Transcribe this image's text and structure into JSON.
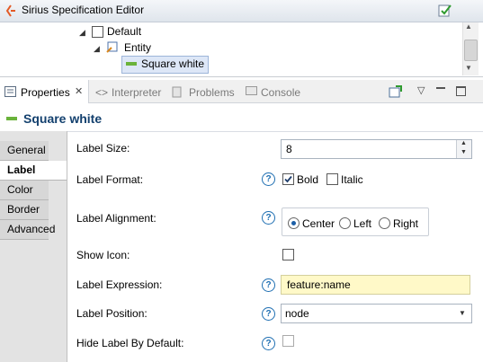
{
  "tree": {
    "title": "Sirius Specification Editor",
    "nodes": [
      {
        "label": "Default"
      },
      {
        "label": "Entity"
      },
      {
        "label": "Square white"
      }
    ]
  },
  "tabs": [
    {
      "label": "Properties",
      "active": true
    },
    {
      "label": "Interpreter",
      "active": false
    },
    {
      "label": "Problems",
      "active": false
    },
    {
      "label": "Console",
      "active": false
    }
  ],
  "section": {
    "title": "Square white"
  },
  "side_tabs": [
    {
      "label": "General"
    },
    {
      "label": "Label"
    },
    {
      "label": "Color"
    },
    {
      "label": "Border"
    },
    {
      "label": "Advanced"
    }
  ],
  "form": {
    "label_size": {
      "label": "Label Size:",
      "value": "8"
    },
    "label_format": {
      "label": "Label Format:",
      "bold": "Bold",
      "italic": "Italic"
    },
    "label_alignment": {
      "label": "Label Alignment:",
      "center": "Center",
      "left": "Left",
      "right": "Right"
    },
    "show_icon": {
      "label": "Show Icon:"
    },
    "label_expression": {
      "label": "Label Expression:",
      "value": "feature:name"
    },
    "label_position": {
      "label": "Label Position:",
      "value": "node"
    },
    "hide_label": {
      "label": "Hide Label By Default:"
    }
  },
  "colors": {
    "accent": "#13406e",
    "selection": "#dde7f7",
    "expression_bg": "#fff9c8",
    "node_green": "#6ab33b"
  }
}
